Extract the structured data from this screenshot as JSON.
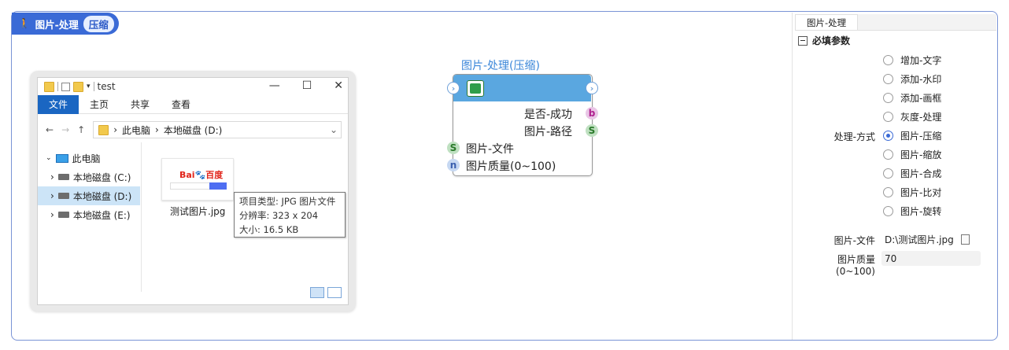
{
  "header": {
    "title": "图片-处理",
    "badge": "压缩"
  },
  "explorer": {
    "folder_name": "test",
    "menu": [
      "文件",
      "主页",
      "共享",
      "查看"
    ],
    "address": {
      "root": "此电脑",
      "drive": "本地磁盘 (D:)"
    },
    "tree": [
      "此电脑",
      "本地磁盘 (C:)",
      "本地磁盘 (D:)",
      "本地磁盘 (E:)"
    ],
    "file": {
      "name": "测试图片.jpg",
      "logo_text": "Bai",
      "logo_text2": "百度"
    },
    "tooltip": [
      "项目类型: JPG 图片文件",
      "分辨率: 323 x 204",
      "大小: 16.5 KB"
    ],
    "window_controls": [
      "—",
      "☐",
      "✕"
    ]
  },
  "node": {
    "title": "图片-处理(压缩)",
    "outputs": [
      {
        "label": "是否-成功",
        "type": "b"
      },
      {
        "label": "图片-路径",
        "type": "S"
      }
    ],
    "inputs": [
      {
        "label": "图片-文件",
        "type": "S"
      },
      {
        "label": "图片质量(0~100)",
        "type": "n"
      }
    ]
  },
  "panel": {
    "tab": "图片-处理",
    "section": "必填参数",
    "mode_label": "处理-方式",
    "options": [
      "增加-文字",
      "添加-水印",
      "添加-画框",
      "灰度-处理",
      "图片-压缩",
      "图片-缩放",
      "图片-合成",
      "图片-比对",
      "图片-旋转"
    ],
    "selected_index": 4,
    "file_label": "图片-文件",
    "file_value": "D:\\测试图片.jpg",
    "quality_label": "图片质量(0~100)",
    "quality_value": "70"
  },
  "colors": {
    "accent": "#3a6ad6",
    "node_header": "#5aa7e0",
    "node_title": "#3a86d9"
  }
}
